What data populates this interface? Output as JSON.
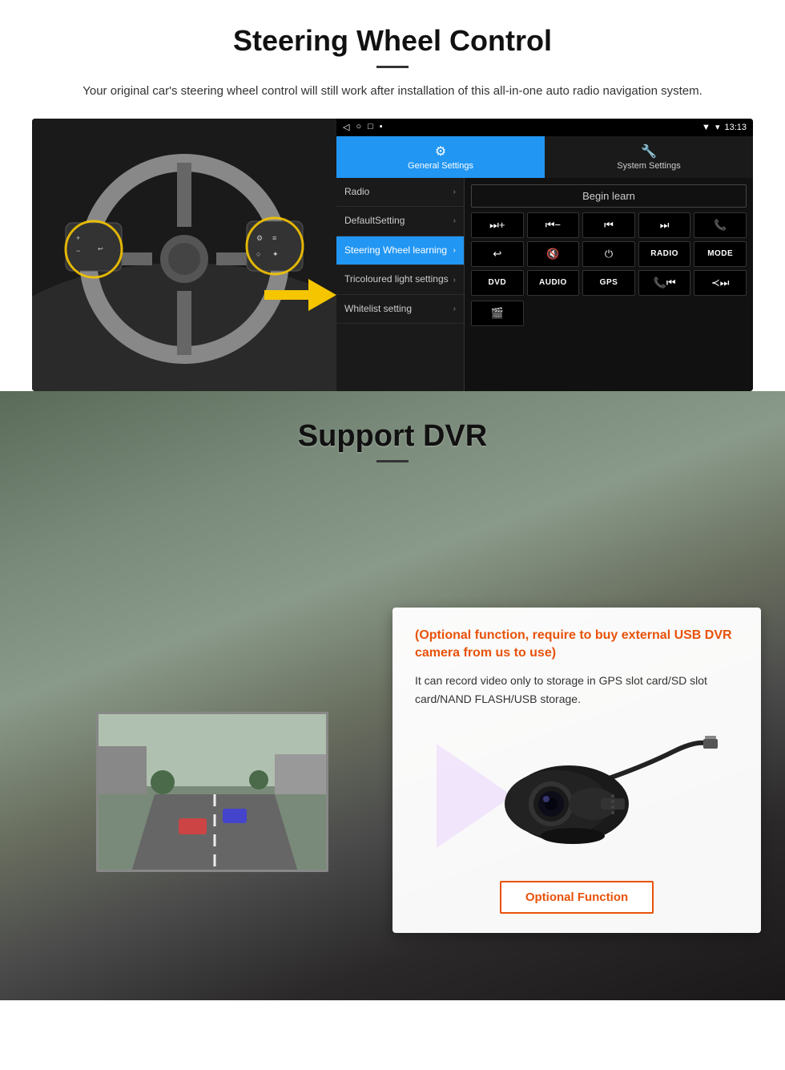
{
  "steering": {
    "title": "Steering Wheel Control",
    "subtitle": "Your original car's steering wheel control will still work after installation of this all-in-one auto radio navigation system.",
    "status_bar": {
      "time": "13:13",
      "signal": "▼",
      "wifi": "▾"
    },
    "nav_icons": [
      "◁",
      "○",
      "□",
      "▪"
    ],
    "tabs": [
      {
        "id": "general",
        "icon": "⚙",
        "label": "General Settings",
        "active": true
      },
      {
        "id": "system",
        "icon": "🔧",
        "label": "System Settings",
        "active": false
      }
    ],
    "menu_items": [
      {
        "label": "Radio",
        "active": false
      },
      {
        "label": "DefaultSetting",
        "active": false
      },
      {
        "label": "Steering Wheel learning",
        "active": true
      },
      {
        "label": "Tricoloured light settings",
        "active": false
      },
      {
        "label": "Whitelist setting",
        "active": false
      }
    ],
    "begin_learn": "Begin learn",
    "control_buttons": [
      "⏮+",
      "⏮−",
      "⏮",
      "⏭",
      "📞",
      "↩",
      "🔇",
      "⏻",
      "RADIO",
      "MODE",
      "DVD",
      "AUDIO",
      "GPS",
      "📞⏮",
      "≺⏭"
    ]
  },
  "dvr": {
    "title": "Support DVR",
    "optional_text": "(Optional function, require to buy external USB DVR camera from us to use)",
    "description": "It can record video only to storage in GPS slot card/SD slot card/NAND FLASH/USB storage.",
    "optional_btn": "Optional Function"
  }
}
